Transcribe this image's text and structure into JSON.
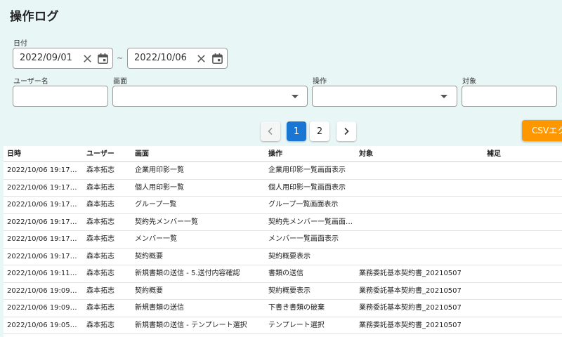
{
  "title": "操作ログ",
  "filters": {
    "date_label": "日付",
    "date_from": "2022/09/01",
    "date_to": "2022/10/06",
    "range_sep": "~",
    "user_label": "ユーザー名",
    "user_value": "",
    "screen_label": "画面",
    "screen_value": "",
    "operation_label": "操作",
    "operation_value": "",
    "target_label": "対象",
    "target_value": ""
  },
  "pagination": {
    "prev": "‹",
    "pages": [
      "1",
      "2"
    ],
    "current": "1",
    "next": "›"
  },
  "csv_button": "CSVエクスポート",
  "table": {
    "headers": [
      "日時",
      "ユーザー",
      "画面",
      "操作",
      "対象",
      "補足"
    ],
    "rows": [
      [
        "2022/10/06 19:17…",
        "森本拓志",
        "企業用印影一覧",
        "企業用印影一覧画面表示",
        "",
        ""
      ],
      [
        "2022/10/06 19:17…",
        "森本拓志",
        "個人用印影一覧",
        "個人用印影一覧画面表示",
        "",
        ""
      ],
      [
        "2022/10/06 19:17…",
        "森本拓志",
        "グループ一覧",
        "グループ一覧画面表示",
        "",
        ""
      ],
      [
        "2022/10/06 19:17…",
        "森本拓志",
        "契約先メンバー一覧",
        "契約先メンバー一覧画面…",
        "",
        ""
      ],
      [
        "2022/10/06 19:17…",
        "森本拓志",
        "メンバー一覧",
        "メンバー一覧画面表示",
        "",
        ""
      ],
      [
        "2022/10/06 19:17…",
        "森本拓志",
        "契約概要",
        "契約概要表示",
        "",
        ""
      ],
      [
        "2022/10/06 19:11…",
        "森本拓志",
        "新規書類の送信 - 5.送付内容確認",
        "書類の送信",
        "業務委託基本契約書_20210507",
        ""
      ],
      [
        "2022/10/06 19:09…",
        "森本拓志",
        "契約概要",
        "契約概要表示",
        "業務委託基本契約書_20210507",
        ""
      ],
      [
        "2022/10/06 19:09…",
        "森本拓志",
        "新規書類の送信",
        "下書き書類の破棄",
        "業務委託基本契約書_20210507",
        ""
      ],
      [
        "2022/10/06 19:05…",
        "森本拓志",
        "新規書類の送信 - テンプレート選択",
        "テンプレート選択",
        "業務委託基本契約書_20210507",
        ""
      ],
      [
        "",
        "",
        "",
        "",
        "",
        ""
      ]
    ]
  },
  "colors": {
    "background": "#e8f6f5",
    "primary": "#1976d2",
    "accent": "#ff9800"
  }
}
